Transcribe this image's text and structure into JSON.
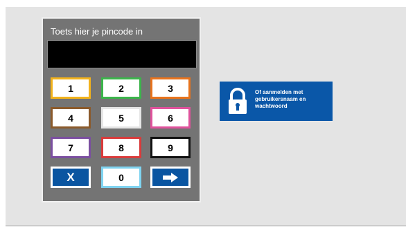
{
  "pinpad": {
    "title": "Toets hier je pincode in",
    "display_value": "",
    "keys": [
      {
        "label": "1",
        "border": "#f2b21c"
      },
      {
        "label": "2",
        "border": "#3cb44b"
      },
      {
        "label": "3",
        "border": "#e8731c"
      },
      {
        "label": "4",
        "border": "#8b5a2b"
      },
      {
        "label": "5",
        "border": "#e6e6e6"
      },
      {
        "label": "6",
        "border": "#e0529c"
      },
      {
        "label": "7",
        "border": "#7b4fa0"
      },
      {
        "label": "8",
        "border": "#d93b3b"
      },
      {
        "label": "9",
        "border": "#111111"
      },
      {
        "label": "X",
        "border": "#ffffff",
        "icon": "clear-icon"
      },
      {
        "label": "0",
        "border": "#7fd3f0"
      },
      {
        "label": "",
        "border": "#ffffff",
        "icon": "arrow-right-icon"
      }
    ]
  },
  "alt_login": {
    "label": "Of aanmelden met gebruikersnaam en wachtwoord",
    "icon": "padlock-icon",
    "color": "#0a57a8"
  },
  "colors": {
    "background": "#e4e4e4",
    "pinpad_background": "#747474",
    "accent_blue": "#0a55a1"
  }
}
